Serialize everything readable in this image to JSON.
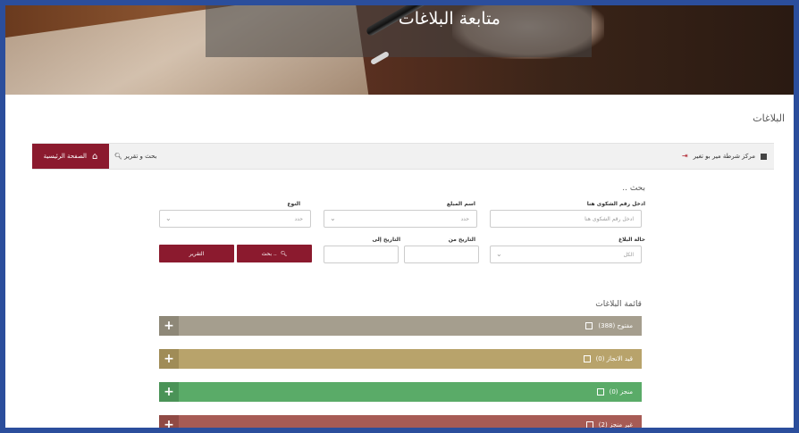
{
  "banner": {
    "title": "متابعة البلاغات"
  },
  "page_heading": "البلاغات",
  "toolbar": {
    "home_label": "الصفحة الرئيسية",
    "search_label": "بحث و تقرير",
    "station_label": "مركز شرطة مير بو تغير"
  },
  "form": {
    "title": "بحث ..",
    "fields": {
      "complaint_no": {
        "label": "ادخل رقم الشكوى هنا",
        "placeholder": "ادخل رقم الشكوى هنا"
      },
      "reporter_name": {
        "label": "اسم المبلغ",
        "value": "حدد"
      },
      "type": {
        "label": "النوع",
        "value": "حدد"
      },
      "status": {
        "label": "حالة البلاغ",
        "value": "الكل"
      },
      "date_from": {
        "label": "التاريخ من",
        "value": ""
      },
      "date_to": {
        "label": "التاريخ إلى",
        "value": ""
      }
    },
    "search_button": "بحث ..",
    "report_button": "التقرير"
  },
  "list": {
    "title": "قائمة البلاغات",
    "bars": [
      {
        "label": "مفتوح (388)",
        "color": "#a59e8e"
      },
      {
        "label": "قيد الانجاز (0)",
        "color": "#b8a36b"
      },
      {
        "label": "منجز (0)",
        "color": "#5aab68"
      },
      {
        "label": "غير منجز (2)",
        "color": "#a75b55"
      }
    ]
  }
}
